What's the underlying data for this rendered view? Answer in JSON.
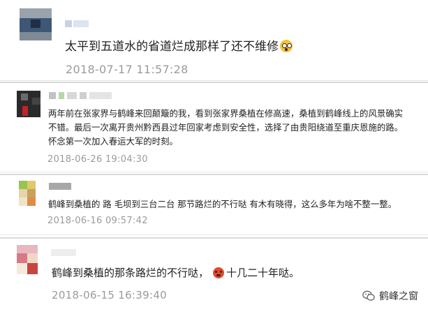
{
  "comments": [
    {
      "username": "",
      "text": "太平到五道水的省道烂成那样了还不维修",
      "emoji": "dizzy-face-emoji",
      "date": "2018-07-17 11:57:28"
    },
    {
      "username": "",
      "lines": [
        "两年前在张家界与鹤峰来回颠簸的我，看到张家界桑植在修高速，桑植到鹤峰线上的风景确实",
        "不错。最后一次离开贵州黔西县过年回家考虑到安全性，选择了由贵阳绕道至重庆恩施的路。",
        "怀念第一次加入春运大军的时刻。"
      ],
      "date": "2018-06-26 19:04:30"
    },
    {
      "username": "",
      "text": "鹤峰到桑植的 路 毛坝到三台二台 那节路烂的不行哒 有木有晓得，这么多年为啥不整一整。",
      "date": "2018-06-16 09:57:42"
    },
    {
      "username": "",
      "text_before": "鹤峰到桑植的那条路烂的不行哒，",
      "emoji": "angry-face-emoji",
      "text_after": "十几二十年哒。",
      "date": "2018-06-15 16:39:40"
    }
  ],
  "watermark": {
    "icon": "wechat-icon",
    "label": "鹤峰之窗"
  },
  "colors": {
    "date": "#9b9b9b",
    "text": "#222222",
    "separator": "#d9d9d9"
  }
}
